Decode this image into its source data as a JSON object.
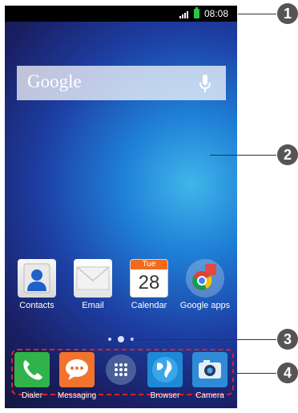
{
  "status_bar": {
    "time": "08:08"
  },
  "search_widget": {
    "label": "Google"
  },
  "home_apps": [
    {
      "label": "Contacts"
    },
    {
      "label": "Email"
    },
    {
      "label": "Calendar",
      "header": "Tue",
      "date": "28"
    },
    {
      "label": "Google apps"
    }
  ],
  "page_indicator": {
    "pages": 3,
    "active_index": 1
  },
  "dock_apps": [
    {
      "label": "Dialer"
    },
    {
      "label": "Messaging"
    },
    {
      "label": ""
    },
    {
      "label": "Browser"
    },
    {
      "label": "Camera"
    }
  ],
  "callouts": [
    "1",
    "2",
    "3",
    "4"
  ],
  "colors": {
    "accent_red": "#e21f26",
    "battery_green": "#27c93f",
    "wallpaper_blue": "#1f7fd6"
  }
}
